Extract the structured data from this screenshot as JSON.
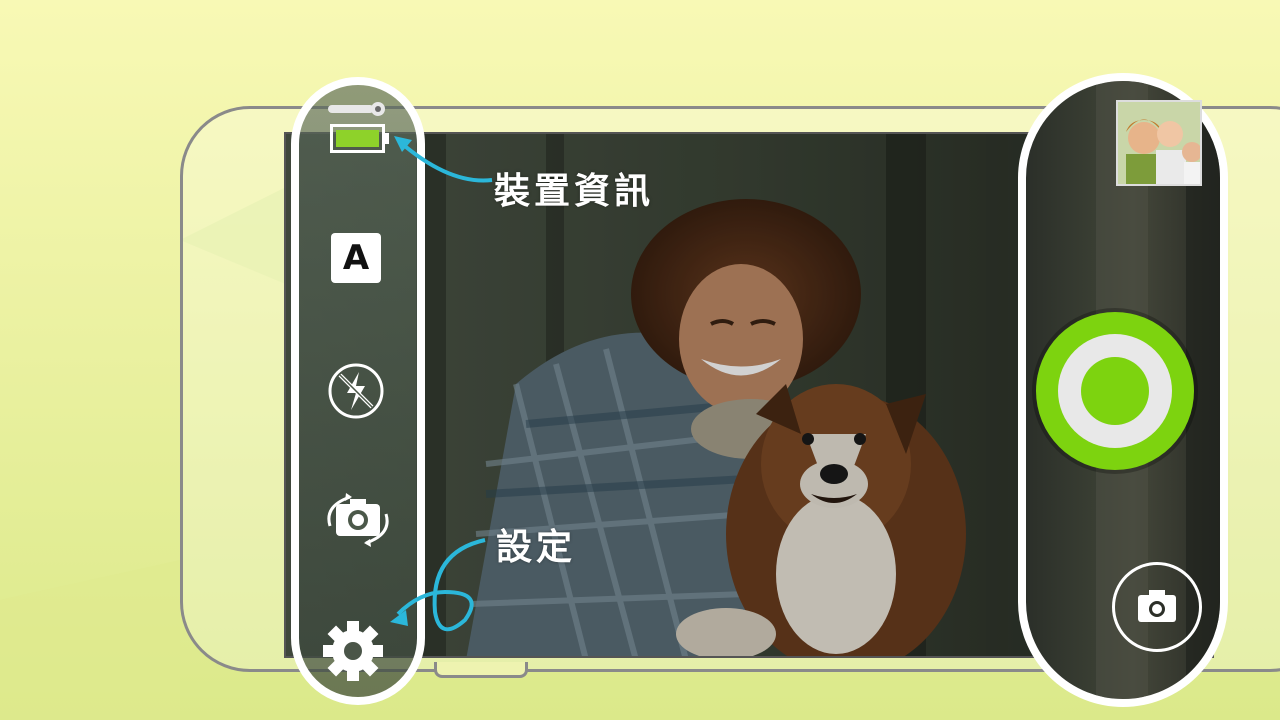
{
  "annotations": {
    "device_info": "裝置資訊",
    "settings": "設定"
  },
  "controls": {
    "mode_badge": "A"
  },
  "colors": {
    "accent_green": "#7dd30f",
    "annotation_arrow": "#29b6d8",
    "background_yellow": "#f8f9b5"
  },
  "icons": {
    "battery": "battery-icon",
    "mode": "auto-mode-icon",
    "flash": "flash-off-icon",
    "switch_camera": "switch-camera-icon",
    "settings": "gear-icon",
    "shutter": "shutter-button",
    "camera": "camera-icon",
    "gallery": "gallery-thumbnail"
  }
}
